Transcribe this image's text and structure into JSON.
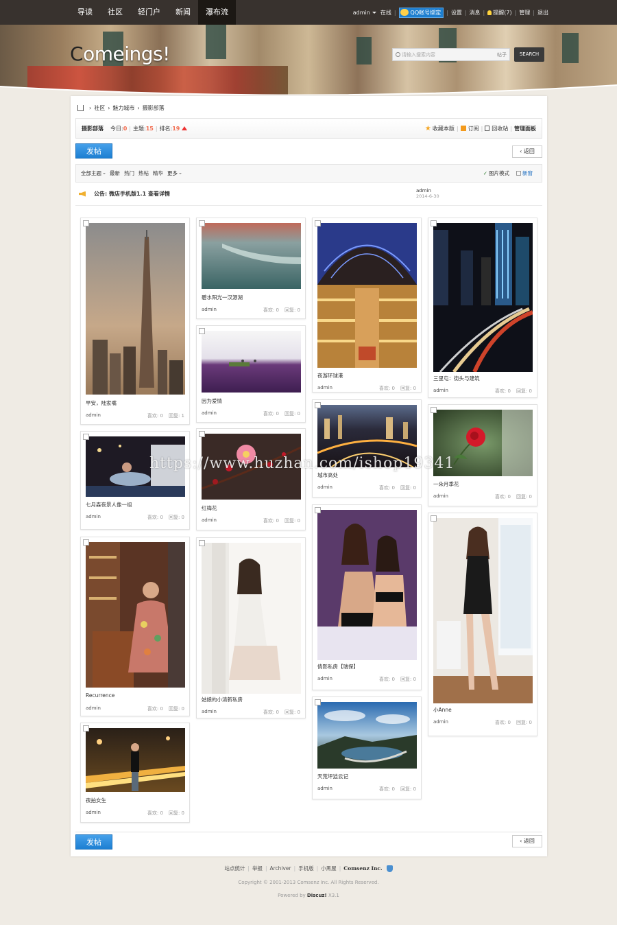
{
  "topnav": {
    "items": [
      {
        "label": "导读"
      },
      {
        "label": "社区"
      },
      {
        "label": "轻门户"
      },
      {
        "label": "新闻"
      },
      {
        "label": "瀑布流",
        "active": true
      }
    ],
    "user": {
      "name": "admin",
      "status": "在线",
      "qq_bind": "QQ帐号绑定",
      "settings": "设置",
      "messages": "消息",
      "reminders": "提醒(7)",
      "manage": "管理",
      "logout": "退出"
    }
  },
  "header": {
    "logo_first": "C",
    "logo_rest": "omeings!",
    "search_placeholder": "请输入搜索内容",
    "search_type": "帖子",
    "search_button": "SEARCH"
  },
  "breadcrumb": {
    "items": [
      "社区",
      "魅力城市",
      "摄影部落"
    ]
  },
  "forum": {
    "name": "摄影部落",
    "today_label": "今日:",
    "today_value": "0",
    "topics_label": "主题:",
    "topics_value": "15",
    "rank_label": "排名:",
    "rank_value": "19",
    "favorite": "收藏本版",
    "subscribe": "订阅",
    "recycle": "回收站",
    "manage_panel": "管理面板"
  },
  "actions": {
    "post": "发帖",
    "back": "返回"
  },
  "toolbar": {
    "all": "全部主题",
    "latest": "最新",
    "hot": "热门",
    "hotthread": "热帖",
    "digest": "精华",
    "more": "更多",
    "picture_mode": "图片模式",
    "new_window": "新窗"
  },
  "notice": {
    "title": "公告: 微店手机版1.1   查看详情",
    "author": "admin",
    "date": "2014-6-30"
  },
  "tiles": [
    {
      "caption": "早安，陆家嘴",
      "author": "admin",
      "likes": "喜欢: 0",
      "replies": "回复: 1"
    },
    {
      "caption": "七月森夜景人像一组",
      "author": "admin",
      "likes": "喜欢: 0",
      "replies": "回复: 0"
    },
    {
      "caption": "Recurrence",
      "author": "admin",
      "likes": "喜欢: 0",
      "replies": "回复: 0"
    },
    {
      "caption": "夜拍女生",
      "author": "admin",
      "likes": "喜欢: 0",
      "replies": "回复: 0"
    },
    {
      "caption": "碧水阳光一汉源湖",
      "author": "admin",
      "likes": "喜欢: 0",
      "replies": "回复: 0"
    },
    {
      "caption": "因为爱情",
      "author": "admin",
      "likes": "喜欢: 0",
      "replies": "回复: 0"
    },
    {
      "caption": "红梅花",
      "author": "admin",
      "likes": "喜欢: 0",
      "replies": "回复: 0"
    },
    {
      "caption": "姑娘的小清新私房",
      "author": "admin",
      "likes": "喜欢: 0",
      "replies": "回复: 0"
    },
    {
      "caption": "夜游环球港",
      "author": "admin",
      "likes": "喜欢: 0",
      "replies": "回复: 0"
    },
    {
      "caption": "城市高处",
      "author": "admin",
      "likes": "喜欢: 0",
      "replies": "回复: 0"
    },
    {
      "caption": "倩影私房【瑞保】",
      "author": "admin",
      "likes": "喜欢: 0",
      "replies": "回复: 0"
    },
    {
      "caption": "天荒坪逍云记",
      "author": "admin",
      "likes": "喜欢: 0",
      "replies": "回复: 0"
    },
    {
      "caption": "三里屯：街头与建筑",
      "author": "admin",
      "likes": "喜欢: 0",
      "replies": "回复: 0"
    },
    {
      "caption": "一朵月季花",
      "author": "admin",
      "likes": "喜欢: 0",
      "replies": "回复: 0"
    },
    {
      "caption": "小Anne",
      "author": "admin",
      "likes": "喜欢: 0",
      "replies": "回复: 0"
    }
  ],
  "footer": {
    "links": [
      "站点统计",
      "举报",
      "Archiver",
      "手机版",
      "小黑屋"
    ],
    "company": "Comsenz Inc.",
    "copyright": "Copyright © 2001-2013 Comsenz Inc.   All Rights Reserved.",
    "powered_prefix": "Powered by",
    "powered_name": "Discuz!",
    "powered_version": "X3.1"
  },
  "watermark": "https://www.huzhan.com/ishop19341"
}
